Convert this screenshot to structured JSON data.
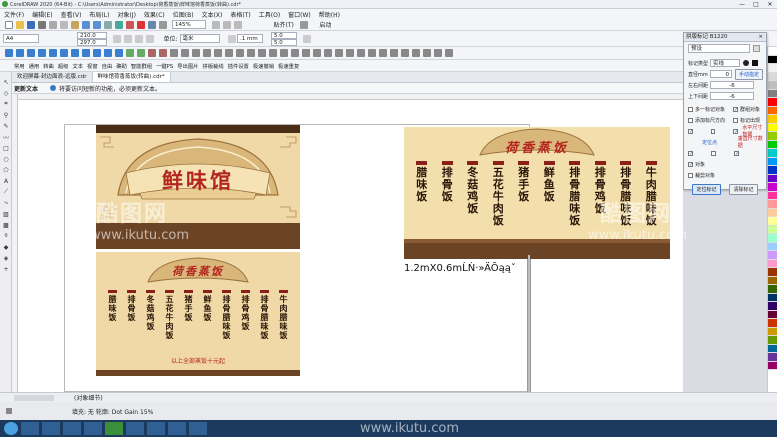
{
  "app": {
    "title": "CorelDRAW 2020 (64-Bit) - C:\\Users\\Administrator\\Desktop\\荷香蒸饭\\鲜味馆荷香蒸饭(转曲).cdr*",
    "window_controls": [
      "—",
      "□",
      "✕"
    ]
  },
  "menu": [
    "文件(F)",
    "编辑(E)",
    "查看(V)",
    "布局(L)",
    "对象(J)",
    "效果(C)",
    "位图(B)",
    "文本(X)",
    "表格(T)",
    "工具(O)",
    "窗口(W)",
    "帮助(H)"
  ],
  "toolbar1": {
    "zoom": "145%",
    "snap_label": "贴齐(T)",
    "launch_label": "启动"
  },
  "propbar": {
    "page_size": "A4",
    "width": "210.0 mm",
    "height": "297.0 mm",
    "units_label": "单位:",
    "units": "毫米",
    "nudge": ".1 mm",
    "dup_x": "5.0 mm",
    "dup_y": "5.0 mm"
  },
  "toolbar2": {
    "items": [
      "常用",
      "通用",
      "转曲",
      "超级",
      "文本",
      "视窗",
      "自由",
      "确助",
      "智能群组",
      "一键PS",
      "导出图片",
      "拼版裁线",
      "插件设置",
      "极速撤销",
      "极速重复"
    ]
  },
  "tabs": [
    {
      "label": "欢迎屏幕-封边面浪-远版.cdr",
      "active": false
    },
    {
      "label": "鲜味馆荷香蒸饭(转曲).cdr*",
      "active": true
    }
  ],
  "hint": {
    "label": "更新文本",
    "message": "将要访问短新的功能，必须更新文本。"
  },
  "docker": {
    "title": "拼版标记 B1220",
    "preset": "预设",
    "mark_type_label": "标记类型",
    "mark_type_value": "实线",
    "diameter_label": "直径mm",
    "diameter_value": "0",
    "color_button": "手动指定",
    "lr_spacing_label": "左右间距",
    "lr_spacing_value": "-6",
    "tb_spacing_label": "上下间距",
    "tb_spacing_value": "-6",
    "options": [
      {
        "label": "多一标记对象",
        "checked": false
      },
      {
        "label": "群组对象",
        "checked": true
      },
      {
        "label": "添加标尺方向",
        "checked": false
      },
      {
        "label": "标记出现",
        "checked": false
      }
    ],
    "side_labels": [
      "水平尺寸数据",
      "垂直尺寸数据"
    ],
    "red_label": "定位点",
    "bottom_options": [
      {
        "label": "对象",
        "checked": true
      },
      {
        "label": "裁剪对象",
        "checked": false
      }
    ],
    "btn_apply": "定位标记",
    "btn_clear": "清除标记"
  },
  "board_left_top": {
    "restaurant_name": "鲜味馆",
    "colors": {
      "frame": "#5a3b22",
      "cream": "#f0d9a6",
      "red": "#b3261e"
    }
  },
  "board_left_bottom": {
    "banner": "荷香蒸饭",
    "dishes": [
      [
        "腊",
        "味",
        "饭"
      ],
      [
        "排",
        "骨",
        "饭"
      ],
      [
        "冬",
        "菇",
        "鸡",
        "饭"
      ],
      [
        "五",
        "花",
        "牛",
        "肉",
        "饭"
      ],
      [
        "猪",
        "手",
        "饭"
      ],
      [
        "鲜",
        "鱼",
        "饭"
      ],
      [
        "排",
        "骨",
        "腊",
        "味",
        "饭"
      ],
      [
        "排",
        "骨",
        "鸡",
        "饭"
      ],
      [
        "排",
        "骨",
        "腊",
        "味",
        "饭"
      ],
      [
        "牛",
        "肉",
        "腊",
        "味",
        "饭"
      ]
    ],
    "footer": "以上全部蒸饭十元起"
  },
  "board_right": {
    "banner": "荷香蒸饭",
    "dishes": [
      [
        "腊",
        "味",
        "饭"
      ],
      [
        "排",
        "骨",
        "饭"
      ],
      [
        "冬",
        "菇",
        "鸡",
        "饭"
      ],
      [
        "五",
        "花",
        "牛",
        "肉",
        "饭"
      ],
      [
        "猪",
        "手",
        "饭"
      ],
      [
        "鲜",
        "鱼",
        "饭"
      ],
      [
        "排",
        "骨",
        "腊",
        "味",
        "饭"
      ],
      [
        "排",
        "骨",
        "鸡",
        "饭"
      ],
      [
        "排",
        "骨",
        "腊",
        "味",
        "饭"
      ],
      [
        "牛",
        "肉",
        "腊",
        "味",
        "饭"
      ]
    ],
    "caption": "1.2mX0.6mĹŃ·»ÄÕąąˇ"
  },
  "watermark": {
    "text": "www.ikutu.com",
    "logo_text": "酷图网"
  },
  "statusbar": {
    "left": "(对象细节)",
    "info": "填充: 无  轮廓: Dot Gain 15%"
  }
}
